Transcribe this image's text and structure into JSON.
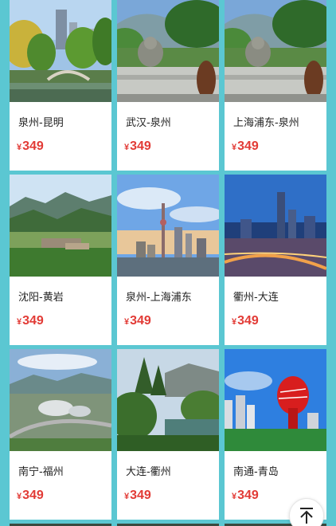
{
  "currency_symbol": "¥",
  "cards": [
    {
      "route": "泉州-昆明",
      "price": "349",
      "image": "garden-pagoda-bridge-photo"
    },
    {
      "route": "武汉-泉州",
      "price": "349",
      "image": "stone-buddha-terrace-photo"
    },
    {
      "route": "上海浦东-泉州",
      "price": "349",
      "image": "stone-buddha-terrace-photo"
    },
    {
      "route": "沈阳-黄岩",
      "price": "349",
      "image": "mountain-valley-village-photo"
    },
    {
      "route": "泉州-上海浦东",
      "price": "349",
      "image": "city-skyline-tower-photo"
    },
    {
      "route": "衢州-大连",
      "price": "349",
      "image": "night-city-skyline-photo"
    },
    {
      "route": "南宁-福州",
      "price": "349",
      "image": "aerial-stadium-city-photo"
    },
    {
      "route": "大连-衢州",
      "price": "349",
      "image": "forest-lake-photo"
    },
    {
      "route": "南通-青岛",
      "price": "349",
      "image": "red-sculpture-plaza-photo"
    }
  ],
  "back_to_top": {
    "icon": "arrow-up-to-top-icon"
  }
}
